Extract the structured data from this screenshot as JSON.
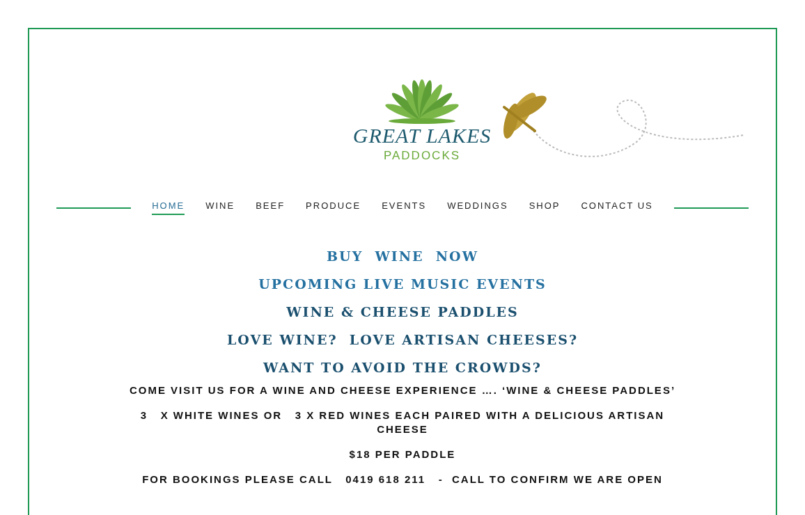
{
  "logo": {
    "title": "GREAT LAKES",
    "subtitle": "PADDOCKS"
  },
  "nav": [
    {
      "label": "HOME",
      "selected": true
    },
    {
      "label": "WINE",
      "selected": false
    },
    {
      "label": "BEEF",
      "selected": false
    },
    {
      "label": "PRODUCE",
      "selected": false
    },
    {
      "label": "EVENTS",
      "selected": false
    },
    {
      "label": "WEDDINGS",
      "selected": false
    },
    {
      "label": "SHOP",
      "selected": false
    },
    {
      "label": "CONTACT US",
      "selected": false
    }
  ],
  "headings": [
    {
      "text": "BUY  WINE  NOW",
      "kind": "link"
    },
    {
      "text": "UPCOMING LIVE MUSIC EVENTS",
      "kind": "link"
    },
    {
      "text": "WINE & CHEESE PADDLES",
      "kind": "heading"
    },
    {
      "text": "LOVE WINE?  LOVE ARTISAN CHEESES?",
      "kind": "heading"
    },
    {
      "text": "WANT TO AVOID THE CROWDS?",
      "kind": "heading"
    }
  ],
  "paragraphs": [
    "COME VISIT US FOR A WINE AND CHEESE EXPERIENCE …. ‘WINE & CHEESE PADDLES’",
    "3   X WHITE WINES OR   3 X RED WINES EACH PAIRED WITH A DELICIOUS ARTISAN CHEESE",
    "$18 PER PADDLE",
    "FOR BOOKINGS PLEASE CALL   0419 618 211   -  CALL TO CONFIRM WE ARE OPEN"
  ]
}
